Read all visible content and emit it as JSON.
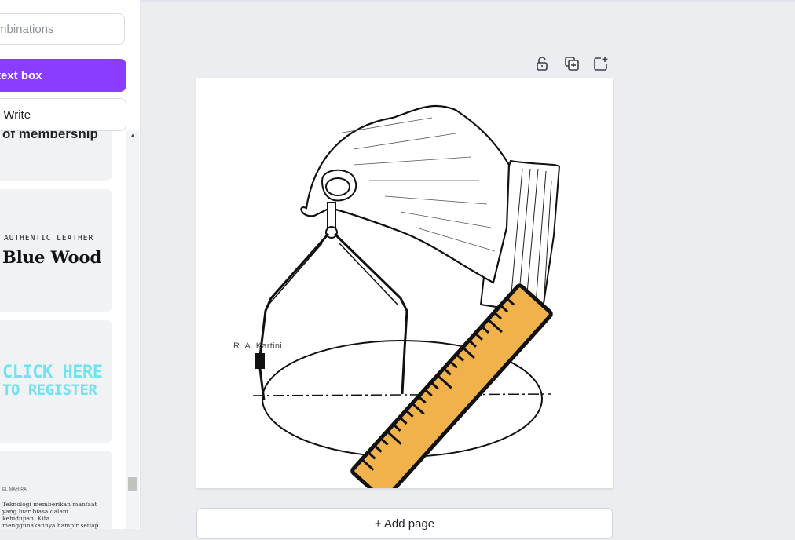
{
  "sidebar": {
    "search": {
      "value": "",
      "placeholder": "Search fonts and combinations",
      "visible_text": "mbinations"
    },
    "add_text_box_label": "text box",
    "magic_write_label": "t Write",
    "templates": [
      {
        "line1": "of membership"
      },
      {
        "small": "AUTHENTIC LEATHER",
        "big": "Blue Wood"
      },
      {
        "line1": "CLICK HERE",
        "line2": "TO REGISTER"
      },
      {
        "small": "EL MAHIRA",
        "paragraph": "Teknologi memberikan manfaat yang luar biasa dalam kehidupan. Kita menggunakannya hampir setiap hari."
      }
    ]
  },
  "toolbar": {
    "lock_icon": "lock-icon",
    "duplicate_icon": "duplicate-icon",
    "add_icon": "add-page-icon"
  },
  "canvas": {
    "text": "R. A. Kartini",
    "illustration": "hand-with-compass-drawing-ellipse",
    "sticker": "ruler"
  },
  "add_page_label": "+ Add page",
  "colors": {
    "accent": "#8b3dff",
    "ruler_fill": "#f2b24b",
    "cyan_text": "#6fe3f0"
  }
}
